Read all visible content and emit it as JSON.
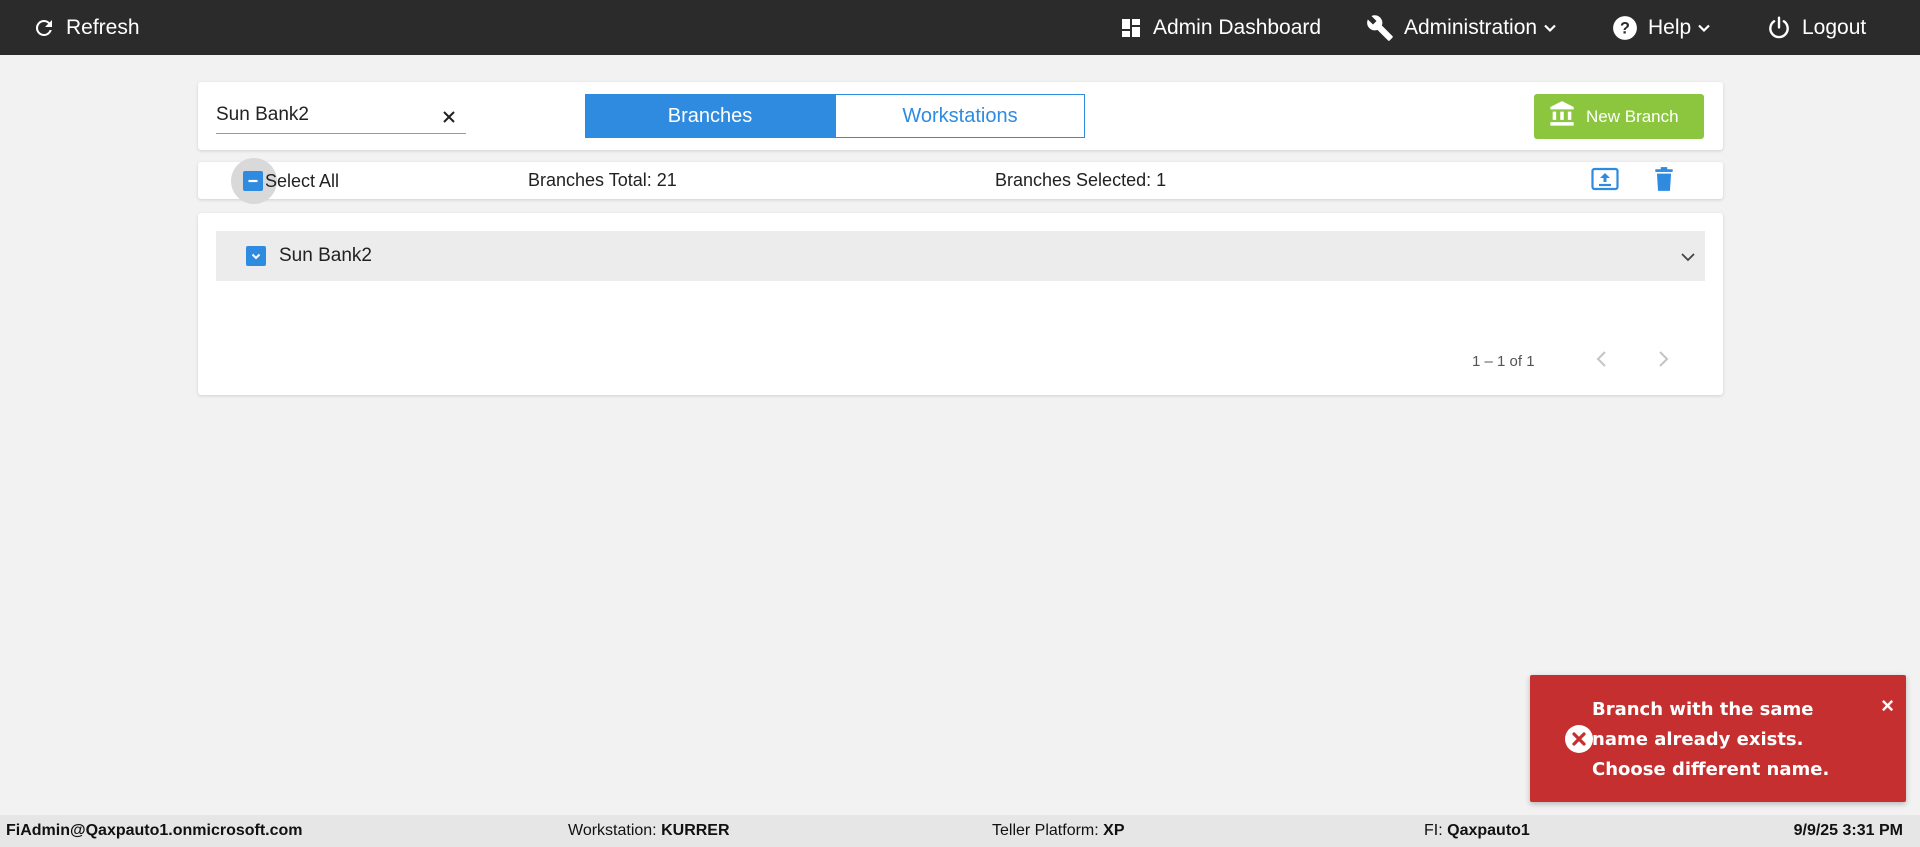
{
  "topbar": {
    "refresh_label": "Refresh",
    "dashboard_label": "Admin Dashboard",
    "administration_label": "Administration",
    "help_label": "Help",
    "logout_label": "Logout"
  },
  "search": {
    "value": "Sun Bank2"
  },
  "tabs": {
    "branches": "Branches",
    "workstations": "Workstations",
    "active": "Branches"
  },
  "new_branch_label": "New Branch",
  "selection_bar": {
    "select_all_label": "Select All",
    "total_label": "Branches Total: 21",
    "selected_label": "Branches Selected: 1"
  },
  "branches": [
    {
      "name": "Sun Bank2",
      "checked": true
    }
  ],
  "pagination": {
    "range_text": "1 – 1 of 1"
  },
  "toast": {
    "message": "Branch with the same name already exists. Choose different name.",
    "close_glyph": "×"
  },
  "footer": {
    "user": "FiAdmin@Qaxpauto1.onmicrosoft.com",
    "workstation_label": "Workstation:",
    "workstation_value": "KURRER",
    "platform_label": "Teller Platform:",
    "platform_value": "XP",
    "fi_label": "FI:",
    "fi_value": "Qaxpauto1",
    "datetime": "9/9/25 3:31 PM"
  },
  "colors": {
    "topbar_bg": "#2b2b2b",
    "accent_blue": "#2f8be0",
    "new_branch_green": "#8cc63f",
    "toast_red": "#c62f2f",
    "page_bg": "#f2f2f2"
  },
  "icons": {
    "refresh": "refresh-icon",
    "dashboard": "dashboard-grid-icon",
    "administration": "wrench-icon",
    "help": "help-circle-icon",
    "logout": "power-icon",
    "new_branch": "bank-building-icon",
    "export": "upload-box-icon",
    "delete": "trash-icon",
    "toast": "error-circle-icon"
  }
}
